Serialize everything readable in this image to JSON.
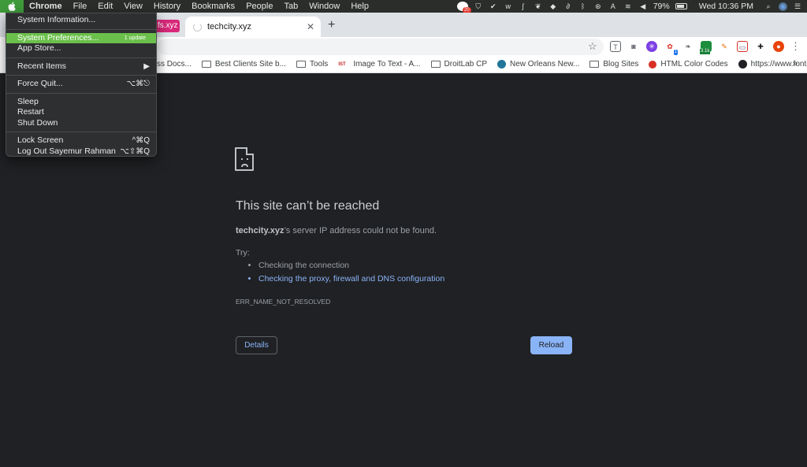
{
  "menubar": {
    "apple_icon": "apple-logo-icon",
    "app_name": "Chrome",
    "items": [
      "File",
      "Edit",
      "View",
      "History",
      "Bookmarks",
      "People",
      "Tab",
      "Window",
      "Help"
    ],
    "status": {
      "notification_count": "20",
      "battery_percent": "79%",
      "clock": "Wed 10:36 PM"
    }
  },
  "apple_menu": {
    "system_information": "System Information...",
    "system_preferences": "System Preferences...",
    "update_badge": "1 update",
    "app_store": "App Store...",
    "recent_items": "Recent Items",
    "recent_arrow": "▶",
    "force_quit": "Force Quit...",
    "force_quit_shortcut": "⌥⌘⎋",
    "sleep": "Sleep",
    "restart": "Restart",
    "shut_down": "Shut Down",
    "lock_screen": "Lock Screen",
    "lock_screen_shortcut": "^⌘Q",
    "log_out": "Log Out Sayemur Rahman",
    "log_out_shortcut": "⌥⇧⌘Q"
  },
  "tabs": {
    "partial_tab": "fs.xyz",
    "active_tab_title": "techcity.xyz",
    "close_glyph": "✕",
    "new_tab_glyph": "+"
  },
  "toolbar": {
    "extension_badge_count": "1",
    "extension_counter": "3.1k"
  },
  "bookmarks": {
    "items": [
      {
        "label": "ss Docs...",
        "icon": "partial"
      },
      {
        "label": "Best Clients Site b...",
        "icon": "folder"
      },
      {
        "label": "Tools",
        "icon": "folder"
      },
      {
        "label": "Image To Text - A...",
        "icon": "ist"
      },
      {
        "label": "DroitLab CP",
        "icon": "folder"
      },
      {
        "label": "New Orleans New...",
        "icon": "wordpress"
      },
      {
        "label": "Blog Sites",
        "icon": "folder"
      },
      {
        "label": "HTML Color Codes",
        "icon": "red-dot"
      },
      {
        "label": "https://www.fonts...",
        "icon": "dark-dot"
      }
    ],
    "ist_label": "IST",
    "more_glyph": "»"
  },
  "error_page": {
    "title": "This site can’t be reached",
    "domain": "techcity.xyz",
    "message_rest": "’s server IP address could not be found.",
    "try_label": "Try:",
    "suggestions": [
      "Checking the connection",
      "Checking the proxy, firewall and DNS configuration"
    ],
    "error_code": "ERR_NAME_NOT_RESOLVED",
    "details_button": "Details",
    "reload_button": "Reload"
  }
}
